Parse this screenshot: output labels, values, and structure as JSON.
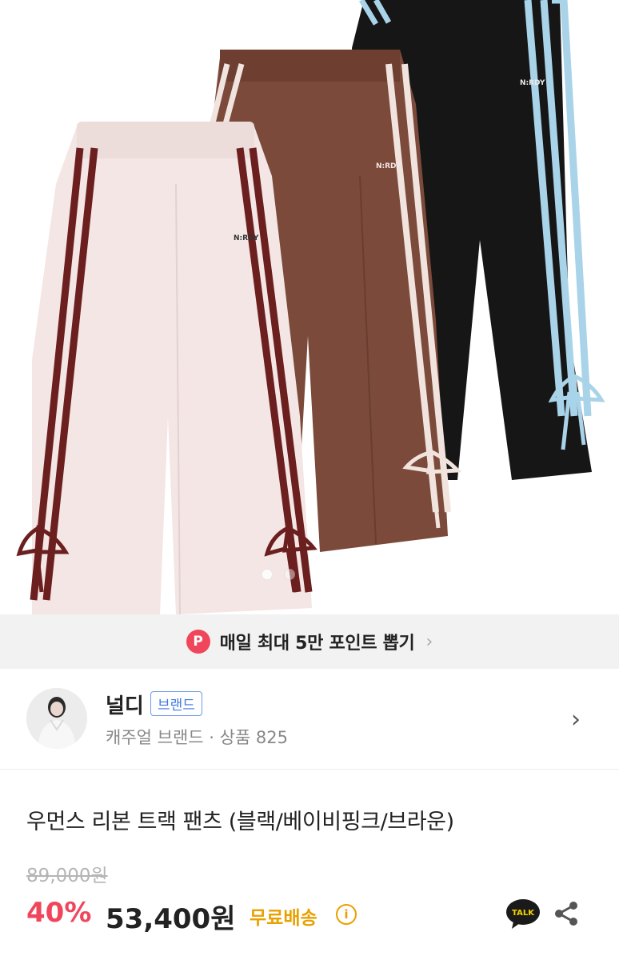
{
  "hero": {
    "logos": [
      "N:RDY",
      "N:RDY",
      "N:RDY"
    ],
    "pager_dots": 2,
    "colors": {
      "pink": "#f3e6e4",
      "brown": "#7b4a3a",
      "black": "#161616",
      "maroon": "#6b1f1f",
      "sky": "#a9d3e8"
    }
  },
  "promo": {
    "badge": "P",
    "text": "매일 최대 5만 포인트 뽑기",
    "chevron": "›"
  },
  "brand": {
    "name": "널디",
    "badge": "브랜드",
    "subtitle": "캐주얼 브랜드 · 상품 825",
    "chevron": "›"
  },
  "product": {
    "title": "우먼스 리본 트랙 팬츠 (블랙/베이비핑크/브라운)",
    "original_price": "89,000원",
    "discount": "40%",
    "price": "53,400원",
    "shipping": "무료배송",
    "info_icon": "i",
    "talk_label": "TALK"
  },
  "colors": {
    "accent": "#f0465c",
    "shipping": "#e8a100",
    "badge": "#3d7ae0"
  }
}
